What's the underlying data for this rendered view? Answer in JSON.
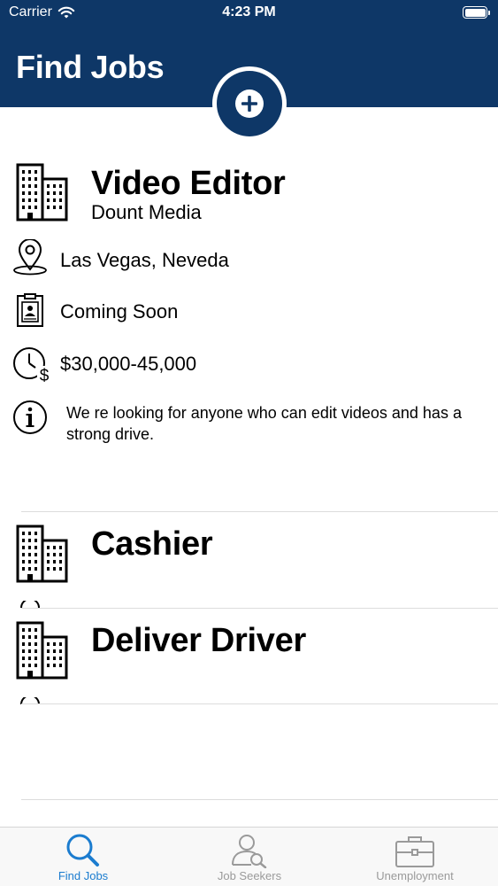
{
  "status_bar": {
    "carrier": "Carrier",
    "time": "4:23 PM"
  },
  "header": {
    "title": "Find Jobs"
  },
  "jobs": [
    {
      "title": "Video Editor",
      "company": "Dount Media",
      "location": "Las Vegas, Neveda",
      "status": "Coming Soon",
      "salary": "$30,000-45,000",
      "description": "We re looking for anyone who can edit videos and has a strong drive."
    },
    {
      "title": "Cashier"
    },
    {
      "title": "Deliver Driver"
    }
  ],
  "tab_bar": {
    "tabs": [
      {
        "label": "Find Jobs",
        "selected": true
      },
      {
        "label": "Job Seekers",
        "selected": false
      },
      {
        "label": "Unemployment",
        "selected": false
      }
    ]
  },
  "colors": {
    "header": "#0e3767",
    "tab_active": "#1b7ccf",
    "tab_inactive": "#9a9a9a"
  },
  "icons": [
    "wifi-icon",
    "battery-icon",
    "plus-icon",
    "building-icon",
    "location-pin-icon",
    "badge-icon",
    "clock-dollar-icon",
    "info-icon",
    "search-icon",
    "user-search-icon",
    "briefcase-icon"
  ]
}
